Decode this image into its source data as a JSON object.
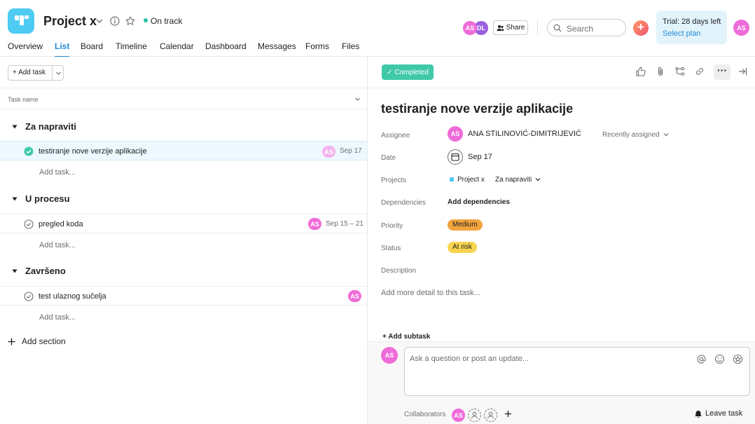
{
  "header": {
    "project_title": "Project x",
    "status": "On track",
    "share_label": "Share",
    "search_placeholder": "Search",
    "trial_text": "Trial: 28 days left",
    "select_plan": "Select plan",
    "members": [
      "AS",
      "DL"
    ],
    "user_avatar": "AS",
    "tabs": [
      "Overview",
      "List",
      "Board",
      "Timeline",
      "Calendar",
      "Dashboard",
      "Messages",
      "Forms",
      "Files"
    ],
    "active_tab": "List"
  },
  "list": {
    "add_task_label": "+ Add task",
    "column_header": "Task name",
    "add_task_link": "Add task...",
    "add_section_label": "Add section",
    "sections": [
      {
        "name": "Za napraviti",
        "tasks": [
          {
            "name": "testiranje nove verzije aplikacije",
            "assignee": "AS",
            "date": "Sep 17",
            "completed": true
          }
        ]
      },
      {
        "name": "U procesu",
        "tasks": [
          {
            "name": "pregled koda",
            "assignee": "AS",
            "date": "Sep 15 – 21",
            "completed": false
          }
        ]
      },
      {
        "name": "Završeno",
        "tasks": [
          {
            "name": "test ulaznog sučelja",
            "assignee": "AS",
            "date": "",
            "completed": false
          }
        ]
      }
    ]
  },
  "detail": {
    "completed_label": "✓ Completed",
    "title": "testiranje nove verzije aplikacije",
    "labels": {
      "assignee": "Assignee",
      "date": "Date",
      "projects": "Projects",
      "dependencies": "Dependencies",
      "priority": "Priority",
      "status": "Status",
      "description": "Description"
    },
    "assignee_initials": "AS",
    "assignee_name": "ANA STILINOVIĆ-DIMITRIJEVIĆ",
    "recently_assigned": "Recently assigned",
    "date_value": "Sep 17",
    "project_name": "Project x",
    "project_section": "Za napraviti",
    "add_dependencies": "Add dependencies",
    "priority_value": "Medium",
    "status_value": "At risk",
    "description_placeholder": "Add more detail to this task...",
    "add_subtask": "+ Add subtask",
    "comment_placeholder": "Ask a question or post an update...",
    "commenter_initials": "AS",
    "collaborators_label": "Collaborators",
    "collaborator_initials": "AS",
    "leave_task": "Leave task"
  },
  "colors": {
    "accent": "#1f8bd6",
    "completed": "#40c9a8",
    "avatar_pink": "#ee6bd8",
    "avatar_purple": "#9b5fe0",
    "priority_medium": "#f1a33e",
    "status_at_risk": "#f8d44f",
    "on_track": "#27c2a6"
  }
}
